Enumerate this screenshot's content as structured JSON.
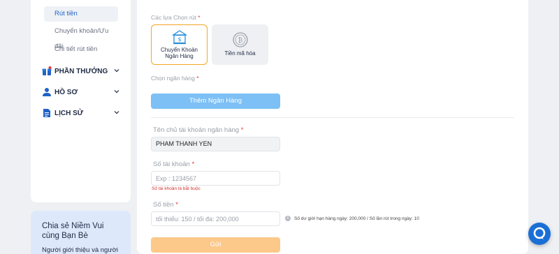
{
  "sidebar": {
    "sub_items": [
      {
        "label": "Rút tiền",
        "active": true
      },
      {
        "label": "Chuyển khoản/Ưu đãi",
        "active": false
      },
      {
        "label": "Chi tiết rút tiền",
        "active": false
      }
    ],
    "main_items": [
      {
        "label": "PHẦN THƯỞNG",
        "icon": "gift-icon"
      },
      {
        "label": "HỒ SƠ",
        "icon": "user-icon"
      },
      {
        "label": "LỊCH SỬ",
        "icon": "document-icon"
      }
    ],
    "promo": {
      "title": "Chia sẻ Niềm Vui cùng Bạn Bè",
      "text": "Người giới thiệu và người"
    }
  },
  "form": {
    "withdraw_options_label": "Các lựa Chọn rút",
    "options": [
      {
        "label": "Chuyển Khoản Ngân Hàng",
        "icon": "bank-icon",
        "selected": true
      },
      {
        "label": "Tiền mã hóa",
        "icon": "crypto-coin-icon",
        "selected": false
      }
    ],
    "choose_bank_label": "Chọn ngân hàng",
    "add_bank_button": "Thêm Ngân Hàng",
    "account_holder_label": "Tên chủ tài khoản ngân hàng",
    "account_holder_value": "PHAM THANH YEN",
    "account_number_label": "Số tài khoản",
    "account_number_placeholder": "Exp : 1234567",
    "account_number_error": "Số tài khoản là bắt buộc",
    "amount_label": "Số tiền",
    "amount_placeholder": "tối thiểu: 150 / tối đa: 200,000",
    "amount_info": "Số dư giới hạn hàng ngày: 200,000 / Số lần rút trong ngày: 10",
    "submit_button": "Gửi",
    "required_mark": "*"
  },
  "colors": {
    "accent_blue": "#1f63c6",
    "add_bank_button": "#7cc0f5",
    "submit_button": "#fcc98a",
    "selected_border": "#f5a623",
    "error": "#d32f2f"
  }
}
